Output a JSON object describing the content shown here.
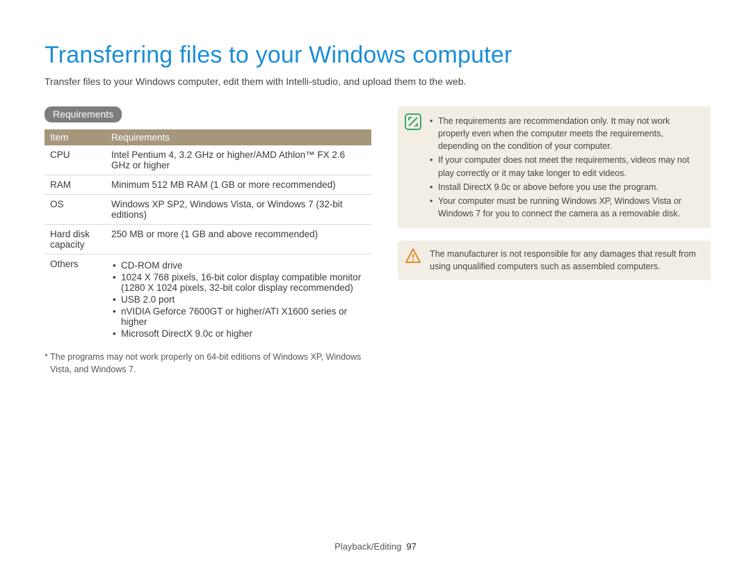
{
  "title": "Transferring files to your Windows computer",
  "intro": "Transfer files to your Windows computer, edit them with Intelli-studio, and upload them to the web.",
  "section_label": "Requirements",
  "table": {
    "head_item": "Item",
    "head_req": "Requirements",
    "rows": [
      {
        "item": "CPU",
        "req": "Intel Pentium 4, 3.2 GHz or higher/AMD Athlon™ FX 2.6 GHz or higher"
      },
      {
        "item": "RAM",
        "req": "Minimum 512 MB RAM (1 GB or more recommended)"
      },
      {
        "item": "OS",
        "req": "Windows XP SP2, Windows Vista, or Windows 7 (32-bit editions)"
      },
      {
        "item": "Hard disk capacity",
        "req": "250 MB or more (1 GB and above recommended)"
      }
    ],
    "others_label": "Others",
    "others_items": [
      "CD-ROM drive",
      "1024 X 768 pixels, 16-bit color display compatible monitor (1280 X 1024 pixels, 32-bit color display recommended)",
      "USB 2.0 port",
      "nVIDIA Geforce 7600GT or higher/ATI X1600 series or higher",
      "Microsoft DirectX 9.0c or higher"
    ]
  },
  "footnote": "* The programs may not work properly on 64-bit editions of Windows XP, Windows Vista, and Windows 7.",
  "note_items": [
    "The requirements are recommendation only. It may not work properly even when the computer meets the requirements, depending on the condition of your computer.",
    "If your computer does not meet the requirements, videos may not play correctly or it may take longer to edit videos.",
    "Install DirectX 9.0c or above before you use the program.",
    "Your computer must be running Windows XP, Windows Vista or Windows 7 for you to connect the camera as a removable disk."
  ],
  "warning_text": "The manufacturer is not responsible for any damages that result from using unqualified computers such as assembled computers.",
  "footer_section": "Playback/Editing",
  "footer_page": "97"
}
